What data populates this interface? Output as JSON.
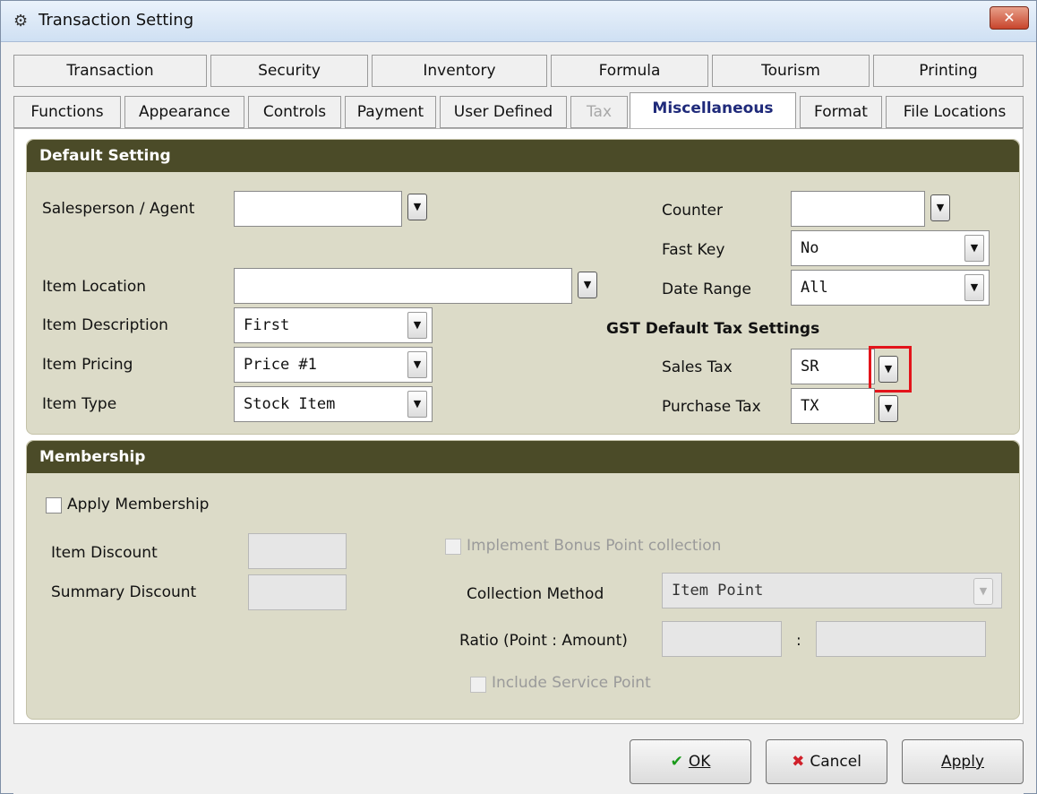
{
  "window": {
    "title": "Transaction Setting",
    "close_label": "✕"
  },
  "tabs_row1": [
    "Transaction",
    "Security",
    "Inventory",
    "Formula",
    "Tourism",
    "Printing"
  ],
  "tabs_row2": [
    "Functions",
    "Appearance",
    "Controls",
    "Payment",
    "User Defined",
    "Tax",
    "Miscellaneous",
    "Format",
    "File Locations"
  ],
  "default_setting": {
    "header": "Default Setting",
    "salesperson_label": "Salesperson / Agent",
    "salesperson_value": "",
    "item_location_label": "Item Location",
    "item_location_value": "",
    "item_description_label": "Item Description",
    "item_description_value": "First",
    "item_pricing_label": "Item Pricing",
    "item_pricing_value": "Price #1",
    "item_type_label": "Item Type",
    "item_type_value": "Stock Item",
    "counter_label": "Counter",
    "counter_value": "",
    "fast_key_label": "Fast Key",
    "fast_key_value": "No",
    "date_range_label": "Date Range",
    "date_range_value": "All",
    "gst_heading": "GST Default Tax Settings",
    "sales_tax_label": "Sales Tax",
    "sales_tax_value": "SR",
    "purchase_tax_label": "Purchase Tax",
    "purchase_tax_value": "TX"
  },
  "membership": {
    "header": "Membership",
    "apply_label": "Apply Membership",
    "item_discount_label": "Item Discount",
    "item_discount_value": "",
    "summary_discount_label": "Summary Discount",
    "summary_discount_value": "",
    "bonus_label": "Implement Bonus Point collection",
    "collection_method_label": "Collection Method",
    "collection_method_value": "Item Point",
    "ratio_label": "Ratio (Point : Amount)",
    "ratio_separator": ":",
    "ratio_point_value": "",
    "ratio_amount_value": "",
    "service_point_label": "Include Service Point"
  },
  "buttons": {
    "ok": "OK",
    "cancel": "Cancel",
    "apply": "Apply"
  },
  "colors": {
    "group_header": "#4b4b28",
    "group_body": "#dcdbc8",
    "highlight": "#e3141b",
    "active_tab_text": "#1f2a7a"
  }
}
